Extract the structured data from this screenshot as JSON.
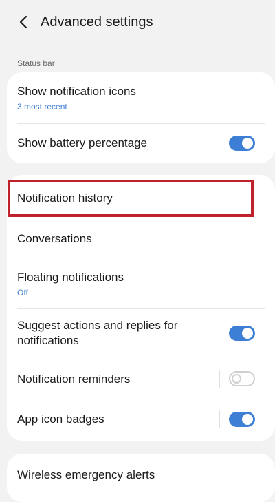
{
  "header": {
    "title": "Advanced settings",
    "back_icon": "chevron-left-icon"
  },
  "status_bar_section": {
    "label": "Status bar",
    "items": [
      {
        "title": "Show notification icons",
        "subtitle": "3 most recent"
      },
      {
        "title": "Show battery percentage",
        "toggle": "on"
      }
    ]
  },
  "notifications_section": {
    "items": [
      {
        "title": "Notification history",
        "highlighted": true
      },
      {
        "title": "Conversations"
      },
      {
        "title": "Floating notifications",
        "subtitle": "Off"
      },
      {
        "title_line1": "Suggest actions and replies for",
        "title_line2": "notifications",
        "toggle": "on"
      },
      {
        "title": "Notification reminders",
        "toggle": "off"
      },
      {
        "title": "App icon badges",
        "toggle": "on"
      }
    ]
  },
  "emergency_section": {
    "items": [
      {
        "title": "Wireless emergency alerts"
      }
    ]
  },
  "colors": {
    "accent": "#3e7fd6",
    "highlight_border": "#c0222b",
    "background": "#f2f2f2",
    "card": "#ffffff"
  }
}
